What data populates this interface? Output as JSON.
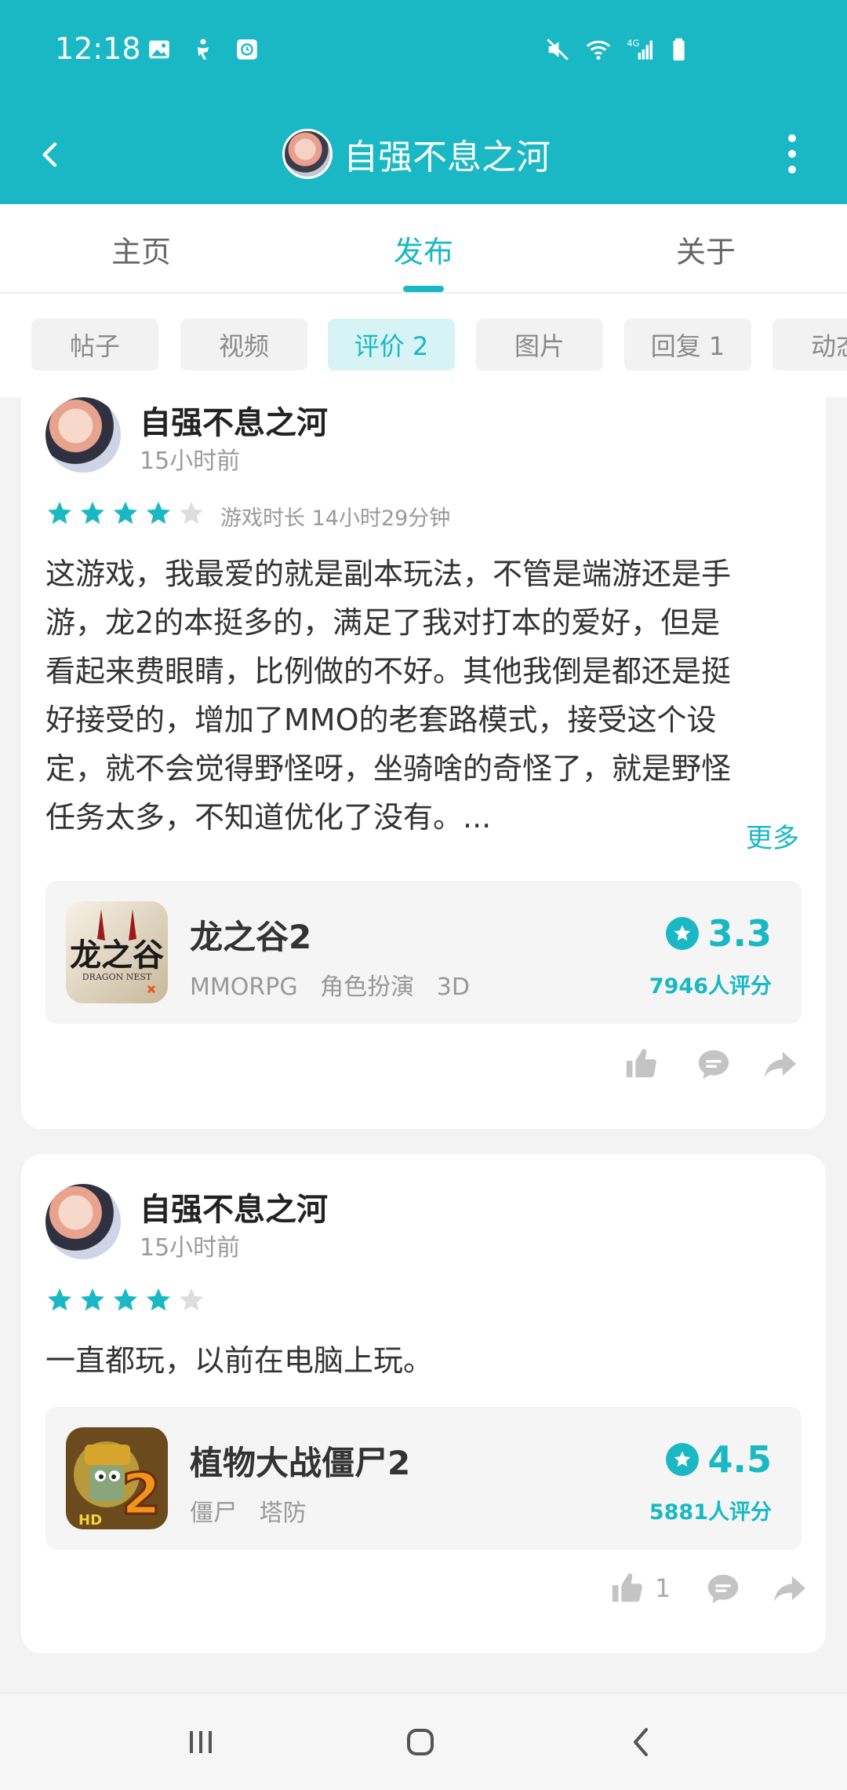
{
  "status_bar": {
    "time": "12:18",
    "icons_left": [
      "image-icon",
      "accessibility-icon",
      "clock-app-icon"
    ],
    "icons_right": [
      "mute-icon",
      "wifi-icon",
      "signal-4g-icon",
      "battery-icon"
    ]
  },
  "app_bar": {
    "title": "自强不息之河",
    "back_icon": "back-arrow-icon",
    "menu_icon": "more-vert-icon"
  },
  "tabs": [
    {
      "label": "主页",
      "active": false
    },
    {
      "label": "发布",
      "active": true
    },
    {
      "label": "关于",
      "active": false
    }
  ],
  "chips": [
    {
      "label": "帖子",
      "active": false
    },
    {
      "label": "视频",
      "active": false
    },
    {
      "label": "评价 2",
      "active": true
    },
    {
      "label": "图片",
      "active": false
    },
    {
      "label": "回复 1",
      "active": false
    },
    {
      "label": "动态",
      "active": false
    }
  ],
  "reviews": [
    {
      "user": "自强不息之河",
      "time": "15小时前",
      "rating": 4,
      "max_rating": 5,
      "play_time": "游戏时长 14小时29分钟",
      "text_lines": [
        "这游戏，我最爱的就是副本玩法，不管是端游还是手",
        "游，龙2的本挺多的，满足了我对打本的爱好，但是",
        "看起来费眼睛，比例做的不好。其他我倒是都还是挺",
        "好接受的，增加了MMO的老套路模式，接受这个设",
        "定，就不会觉得野怪呀，坐骑啥的奇怪了，就是野怪",
        "任务太多，不知道优化了没有。..."
      ],
      "more_label": "更多",
      "game": {
        "name": "龙之谷2",
        "tags": "MMORPG   角色扮演   3D",
        "score": "3.3",
        "rating_count": "7946人评分",
        "icon_text": "龙之谷",
        "icon_sub": "DRAGON NEST"
      },
      "likes": ""
    },
    {
      "user": "自强不息之河",
      "time": "15小时前",
      "rating": 4,
      "max_rating": 5,
      "text_lines": [
        "一直都玩，以前在电脑上玩。"
      ],
      "game": {
        "name": "植物大战僵尸2",
        "tags": "僵尸   塔防",
        "score": "4.5",
        "rating_count": "5881人评分",
        "icon_text": "2",
        "icon_sub": "HD"
      },
      "likes": "1"
    }
  ],
  "nav": [
    "recent-apps-icon",
    "home-icon",
    "back-icon"
  ],
  "colors": {
    "accent": "#19b8c4",
    "star_empty": "#dddddd"
  }
}
